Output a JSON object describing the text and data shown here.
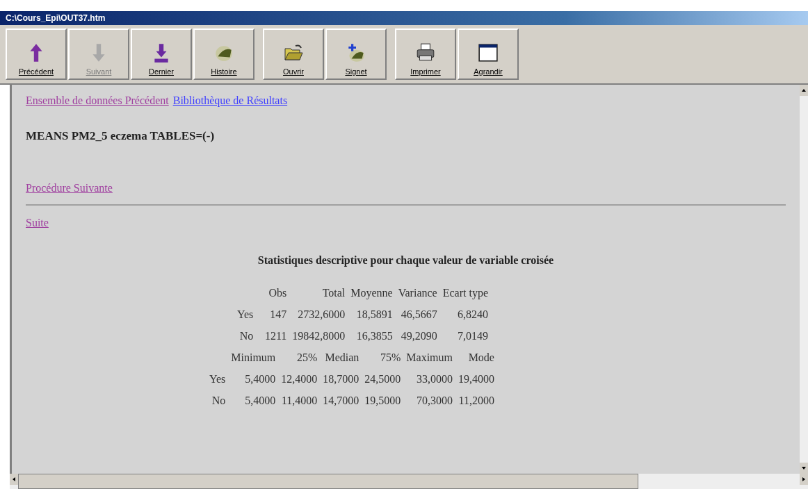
{
  "window": {
    "title": "C:\\Cours_Epi\\OUT37.htm"
  },
  "toolbar": [
    {
      "kind": "up",
      "label": "Précédent",
      "disabled": false
    },
    {
      "kind": "down",
      "label": "Suivant",
      "disabled": true
    },
    {
      "kind": "last",
      "label": "Dernier",
      "disabled": false
    },
    {
      "kind": "history",
      "label": "Histoire",
      "disabled": false
    },
    {
      "kind": "open",
      "label": "Ouvrir",
      "disabled": false
    },
    {
      "kind": "bookmark",
      "label": "Signet",
      "disabled": false
    },
    {
      "kind": "print",
      "label": "Imprimer",
      "disabled": false
    },
    {
      "kind": "window",
      "label": "Agrandir",
      "disabled": false
    }
  ],
  "nav_links": [
    {
      "text": "Ensemble de données Précédent",
      "visited": true
    },
    {
      "text": "Bibliothèque de Résultats",
      "visited": false
    }
  ],
  "procedure": "MEANS PM2_5 eczema TABLES=(-)",
  "next_link": {
    "text": "Procédure Suivante",
    "visited": true
  },
  "suite_link": {
    "text": "Suite",
    "visited": true
  },
  "stats": {
    "title": "Statistiques descriptive pour chaque valeur de variable croisée",
    "tables": [
      {
        "columns": [
          "",
          "Obs",
          "Total",
          "Moyenne",
          "Variance",
          "Ecart type"
        ],
        "rows": [
          [
            "Yes",
            "147",
            "2732,6000",
            "18,5891",
            "46,5667",
            "6,8240"
          ],
          [
            "No",
            "1211",
            "19842,8000",
            "16,3855",
            "49,2090",
            "7,0149"
          ]
        ]
      },
      {
        "columns": [
          "",
          "Minimum",
          "25%",
          "Median",
          "75%",
          "Maximum",
          "Mode"
        ],
        "rows": [
          [
            "Yes",
            "5,4000",
            "12,4000",
            "18,7000",
            "24,5000",
            "33,0000",
            "19,4000"
          ],
          [
            "No",
            "5,4000",
            "11,4000",
            "14,7000",
            "19,5000",
            "70,3000",
            "11,2000"
          ]
        ]
      }
    ]
  }
}
